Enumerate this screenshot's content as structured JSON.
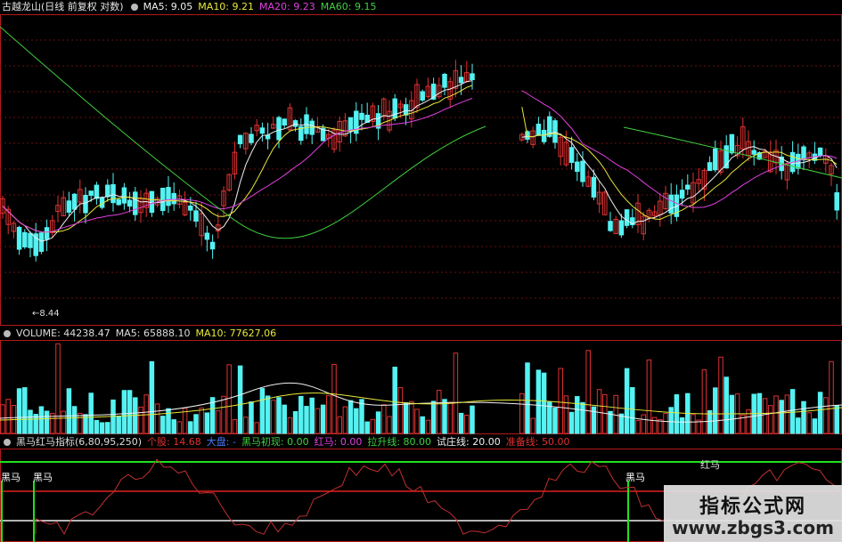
{
  "main_header": {
    "title": "古越龙山(日线 前复权 对数)",
    "ma5": "MA5: 9.05",
    "ma10": "MA10: 9.21",
    "ma20": "MA20: 9.23",
    "ma60": "MA60: 9.15"
  },
  "low_marker": "8.44",
  "volume_header": {
    "title": "VOLUME: 44238.47",
    "ma5": "MA5: 65888.10",
    "ma10": "MA10: 77627.06"
  },
  "indicator_header": {
    "title": "黑马红马指标(6,80,95,250)",
    "gegu": "个股: 14.68",
    "dapan": "大盘: -",
    "heima_chuxian": "黑马初现: 0.00",
    "hongma": "红马: 0.00",
    "lashengxian": "拉升线: 80.00",
    "shizhuangxian": "试庄线: 20.00",
    "zhunbeixian": "准备线: 50.00"
  },
  "heima_labels": [
    "黑马",
    "黑马",
    "黑马"
  ],
  "hongma_label": "红马",
  "watermark": {
    "line1": "指标公式网",
    "line2": "www.zbgs3.com"
  },
  "colors": {
    "up": "#e03232",
    "down": "#54f2f2",
    "ma5": "#f0f0f0",
    "ma10": "#e8e83a",
    "ma20": "#e040e0",
    "ma60": "#40d040",
    "green_line": "#20e020",
    "red_line": "#e02020",
    "white_line": "#f0f0f0",
    "panel_border": "#b01a1a",
    "grid": "#6a1010"
  }
}
